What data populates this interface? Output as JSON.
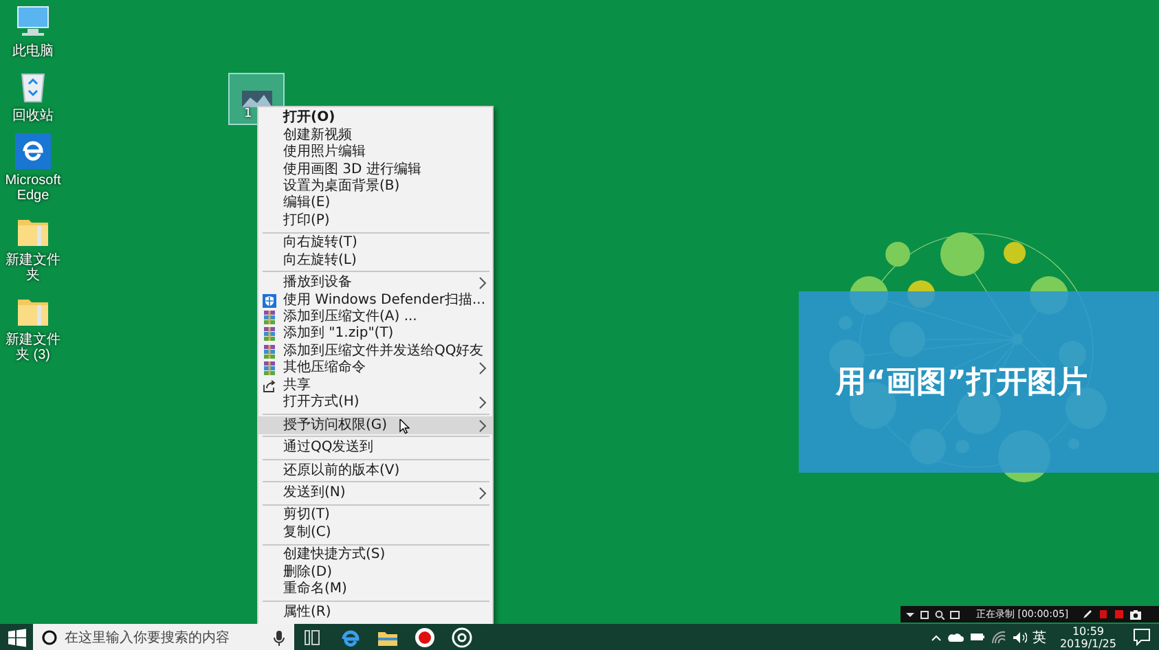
{
  "desktop_icons": [
    {
      "label": "此电脑",
      "kind": "computer"
    },
    {
      "label": "回收站",
      "kind": "recycle"
    },
    {
      "label": "Microsoft Edge",
      "kind": "edge"
    },
    {
      "label": "新建文件夹",
      "kind": "folder"
    },
    {
      "label": "新建文件夹 (3)",
      "kind": "folder"
    }
  ],
  "selected_file": {
    "label": "1",
    "selected": true
  },
  "context_menu": {
    "items": [
      {
        "kind": "item",
        "label": "打开(O)",
        "default": true,
        "selected": false,
        "submenu": false
      },
      {
        "kind": "item",
        "label": "创建新视频",
        "default": false,
        "selected": false,
        "submenu": false
      },
      {
        "kind": "item",
        "label": "使用照片编辑",
        "default": false,
        "selected": false,
        "submenu": false
      },
      {
        "kind": "item",
        "label": "使用画图 3D 进行编辑",
        "default": false,
        "selected": false,
        "submenu": false
      },
      {
        "kind": "item",
        "label": "设置为桌面背景(B)",
        "default": false,
        "selected": false,
        "submenu": false
      },
      {
        "kind": "item",
        "label": "编辑(E)",
        "default": false,
        "selected": false,
        "submenu": false
      },
      {
        "kind": "item",
        "label": "打印(P)",
        "default": false,
        "selected": false,
        "submenu": false
      },
      {
        "kind": "separator"
      },
      {
        "kind": "item",
        "label": "向右旋转(T)",
        "default": false,
        "selected": false,
        "submenu": false
      },
      {
        "kind": "item",
        "label": "向左旋转(L)",
        "default": false,
        "selected": false,
        "submenu": false
      },
      {
        "kind": "separator"
      },
      {
        "kind": "item",
        "label": "播放到设备",
        "default": false,
        "selected": false,
        "submenu": true
      },
      {
        "kind": "shield-item",
        "label": "使用 Windows Defender扫描...",
        "default": false,
        "selected": false,
        "submenu": false
      },
      {
        "kind": "archive-item",
        "label": "添加到压缩文件(A) ...",
        "default": false,
        "selected": false,
        "submenu": false
      },
      {
        "kind": "archive-item",
        "label": "添加到 \"1.zip\"(T)",
        "default": false,
        "selected": false,
        "submenu": false
      },
      {
        "kind": "archive-item",
        "label": "添加到压缩文件并发送给QQ好友",
        "default": false,
        "selected": false,
        "submenu": false
      },
      {
        "kind": "archive-item",
        "label": "其他压缩命令",
        "default": false,
        "selected": false,
        "submenu": true
      },
      {
        "kind": "share-item",
        "label": "共享",
        "default": false,
        "selected": false,
        "submenu": false
      },
      {
        "kind": "item",
        "label": "打开方式(H)",
        "default": false,
        "selected": false,
        "submenu": true
      },
      {
        "kind": "separator"
      },
      {
        "kind": "item",
        "label": "授予访问权限(G)",
        "default": false,
        "selected": true,
        "submenu": true
      },
      {
        "kind": "separator"
      },
      {
        "kind": "item",
        "label": "通过QQ发送到",
        "default": false,
        "selected": false,
        "submenu": false
      },
      {
        "kind": "separator"
      },
      {
        "kind": "item",
        "label": "还原以前的版本(V)",
        "default": false,
        "selected": false,
        "submenu": false
      },
      {
        "kind": "separator"
      },
      {
        "kind": "item",
        "label": "发送到(N)",
        "default": false,
        "selected": false,
        "submenu": true
      },
      {
        "kind": "separator"
      },
      {
        "kind": "item",
        "label": "剪切(T)",
        "default": false,
        "selected": false,
        "submenu": false
      },
      {
        "kind": "item",
        "label": "复制(C)",
        "default": false,
        "selected": false,
        "submenu": false
      },
      {
        "kind": "separator"
      },
      {
        "kind": "item",
        "label": "创建快捷方式(S)",
        "default": false,
        "selected": false,
        "submenu": false
      },
      {
        "kind": "item",
        "label": "删除(D)",
        "default": false,
        "selected": false,
        "submenu": false
      },
      {
        "kind": "item",
        "label": "重命名(M)",
        "default": false,
        "selected": false,
        "submenu": false
      },
      {
        "kind": "separator"
      },
      {
        "kind": "item",
        "label": "属性(R)",
        "default": false,
        "selected": false,
        "submenu": false
      }
    ]
  },
  "caption": {
    "text": "用“画图”打开图片"
  },
  "recording_bar": {
    "status": "正在录制 [00:00:05]"
  },
  "taskbar": {
    "search": {
      "placeholder": "在这里输入你要搜索的内容"
    },
    "apps": [
      {
        "kind": "task-view"
      },
      {
        "kind": "edge"
      },
      {
        "kind": "folder"
      },
      {
        "kind": "record"
      },
      {
        "kind": "target"
      }
    ],
    "tray": {
      "ime": "英",
      "time": "10:59",
      "date": "2019/1/25"
    }
  }
}
